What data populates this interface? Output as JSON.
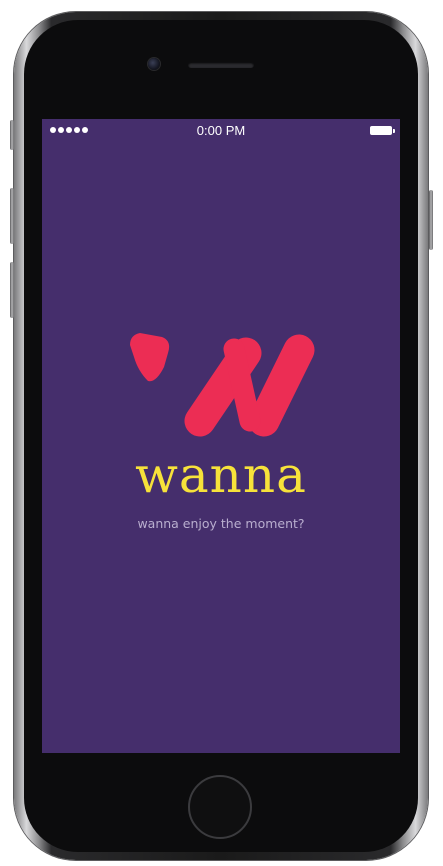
{
  "status_bar": {
    "time": "0:00 PM",
    "signal_icon": "signal-dots-icon",
    "battery_icon": "battery-icon"
  },
  "app": {
    "logo_icon": "wanna-w-logo-icon",
    "name": "wanna",
    "tagline": "wanna enjoy the moment?"
  },
  "colors": {
    "background": "#452e6c",
    "brand_yellow": "#f7e23a",
    "logo_pink": "#ec2d54",
    "tagline": "#b9aecf"
  }
}
